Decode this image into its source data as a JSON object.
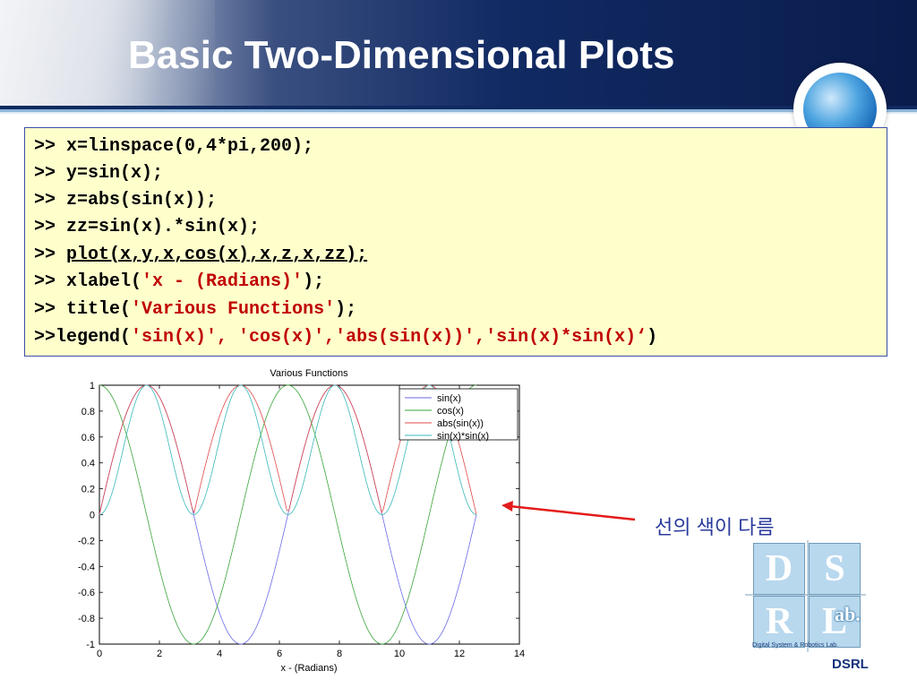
{
  "slide": {
    "title": "Basic Two-Dimensional Plots"
  },
  "code": {
    "lines": [
      {
        "prompt": ">> ",
        "text": "x=linspace(0,4*pi,200);"
      },
      {
        "prompt": ">> ",
        "text": "y=sin(x);"
      },
      {
        "prompt": ">> ",
        "text": "z=abs(sin(x));"
      },
      {
        "prompt": ">> ",
        "text": "zz=sin(x).*sin(x);"
      },
      {
        "prompt": ">> ",
        "text": "plot(x,y,x,cos(x),x,z,x,zz);"
      },
      {
        "prompt": ">> ",
        "pre": "xlabel(",
        "str": "'x - (Radians)'",
        "post": ");"
      },
      {
        "prompt": ">> ",
        "pre": "title(",
        "str": "'Various Functions'",
        "post": ");"
      },
      {
        "prompt": ">>",
        "pre": "legend(",
        "str": "'sin(x)', 'cos(x)','abs(sin(x))','sin(x)*sin(x)‘",
        "post": ")"
      }
    ]
  },
  "annotation": {
    "text": "선의 색이 다름"
  },
  "logo": {
    "letters": [
      "D",
      "S",
      "R",
      "L"
    ],
    "lab": "ab.",
    "caption": "Digital System & Robotics Lab.",
    "footer": "DSRL"
  },
  "chart_data": {
    "type": "line",
    "title": "Various Functions",
    "xlabel": "x - (Radians)",
    "ylabel": "",
    "xlim": [
      0,
      14
    ],
    "ylim": [
      -1,
      1
    ],
    "xticks": [
      0,
      2,
      4,
      6,
      8,
      10,
      12,
      14
    ],
    "yticks": [
      -1,
      -0.8,
      -0.6,
      -0.4,
      -0.2,
      0,
      0.2,
      0.4,
      0.6,
      0.8,
      1
    ],
    "x_range": [
      0,
      12.566
    ],
    "samples": 200,
    "legend_position": "top-right",
    "series": [
      {
        "name": "sin(x)",
        "expr": "sin(x)",
        "color": "#6a6ae8"
      },
      {
        "name": "cos(x)",
        "expr": "cos(x)",
        "color": "#3aa53a"
      },
      {
        "name": "abs(sin(x))",
        "expr": "abs(sin(x))",
        "color": "#e04848"
      },
      {
        "name": "sin(x)*sin(x)",
        "expr": "sin(x)*sin(x)",
        "color": "#3ab8b8"
      }
    ]
  }
}
